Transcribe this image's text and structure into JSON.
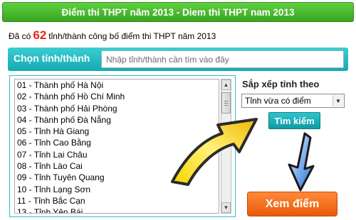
{
  "header": {
    "title": "Điểm thi THPT năm 2013 - Diem thi THPT nam 2013"
  },
  "summary": {
    "prefix": "Đã có",
    "count": "62",
    "suffix": "tỉnh/thành công bố điểm thi THPT năm 2013"
  },
  "search": {
    "label": "Chọn tỉnh/thành",
    "placeholder": "Nhập tỉnh/thành cần tìm vào đây",
    "button_label": "Tìm kiếm"
  },
  "province_list": {
    "items": [
      "01 - Thành phố Hà Nội",
      "02 - Thành phố Hồ Chí Minh",
      "03 - Thành phố Hải Phòng",
      "04 - Thành phố Đà Nẵng",
      "05 - Tỉnh Hà Giang",
      "06 - Tỉnh Cao Bằng",
      "07 - Tỉnh Lai Châu",
      "08 - Tỉnh Lào Cai",
      "09 - Tỉnh Tuyên Quang",
      "10 - Tỉnh Lạng Sơn",
      "11 - Tỉnh Bắc Cạn",
      "13 - Tỉnh Yên Bái"
    ]
  },
  "sort": {
    "label": "Sắp xếp tỉnh theo",
    "selected": "Tỉnh vừa có điểm"
  },
  "view_button": {
    "label": "Xem điểm"
  },
  "icons": {
    "big_arrow": "yellow-arrow-icon",
    "small_arrow": "blue-arrow-icon",
    "dropdown": "chevron-down-icon"
  },
  "colors": {
    "header_green": "#3aa521",
    "teal": "#16a9b2",
    "count_red": "#e02a1c",
    "orange_button": "#e95a07",
    "arrow_yellow": "#f5c400",
    "arrow_blue": "#3a7fd6"
  }
}
